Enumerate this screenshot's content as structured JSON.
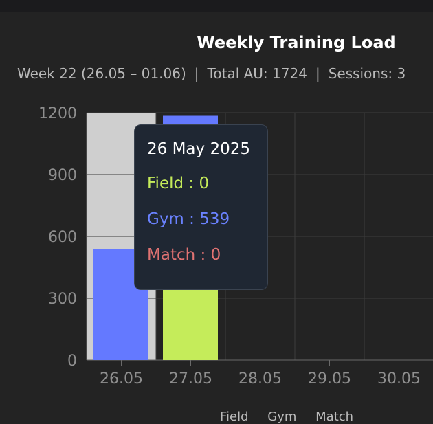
{
  "header": {
    "title": "Weekly Training Load",
    "week": "Week 22 (26.05 – 01.06)",
    "total": "Total AU: 1724",
    "sessions": "Sessions: 3",
    "separator": "|"
  },
  "tooltip": {
    "date": "26 May 2025",
    "rows": [
      {
        "label": "Field",
        "value": "0",
        "color": "#c5ec5a"
      },
      {
        "label": "Gym",
        "value": "539",
        "color": "#6a82ff"
      },
      {
        "label": "Match",
        "value": "0",
        "color": "#e07272"
      }
    ]
  },
  "legend": [
    "Field",
    "Gym",
    "Match"
  ],
  "chart_data": {
    "type": "bar",
    "categories": [
      "26.05",
      "27.05",
      "28.05",
      "29.05",
      "30.05"
    ],
    "series": [
      {
        "name": "Gym",
        "color": "#6479ff",
        "values": [
          539,
          1185,
          0,
          0,
          0
        ]
      },
      {
        "name": "Field",
        "color": "#c5ec5a",
        "values": [
          0,
          590,
          0,
          0,
          0
        ]
      },
      {
        "name": "Match",
        "color": "#e07272",
        "values": [
          0,
          0,
          0,
          0,
          0
        ]
      }
    ],
    "highlighted_category": "26.05",
    "yticks": [
      0,
      300,
      600,
      900,
      1200
    ],
    "ylim": [
      0,
      1200
    ],
    "grid": true
  }
}
